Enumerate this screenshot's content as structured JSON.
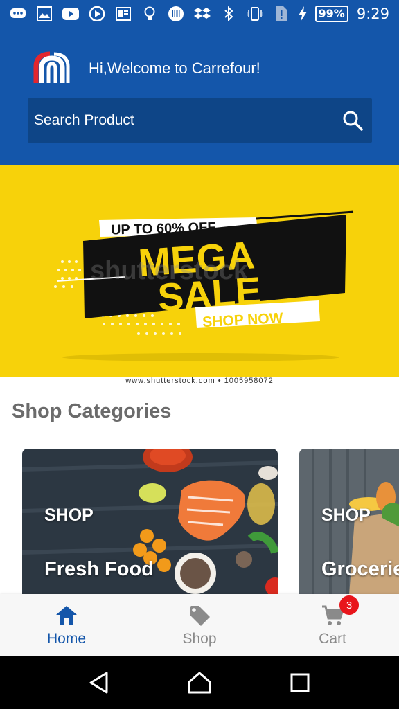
{
  "status_bar": {
    "battery": "99%",
    "time": "9:29"
  },
  "header": {
    "welcome": "Hi,Welcome to Carrefour!",
    "search_placeholder": "Search Product"
  },
  "banner": {
    "line1": "UP TO 60% OFF",
    "line2": "MEGA",
    "line3": "SALE",
    "cta": "SHOP NOW",
    "watermark": "shutterstock",
    "credit": "www.shutterstock.com • 1005958072"
  },
  "categories": {
    "title": "Shop Categories",
    "items": [
      {
        "tag": "SHOP",
        "name": "Fresh Food"
      },
      {
        "tag": "SHOP",
        "name": "Groceries"
      }
    ]
  },
  "bottom_nav": {
    "items": [
      {
        "label": "Home",
        "icon": "home-icon",
        "active": true
      },
      {
        "label": "Shop",
        "icon": "tag-icon",
        "active": false
      },
      {
        "label": "Cart",
        "icon": "cart-icon",
        "active": false,
        "badge": "3"
      }
    ]
  },
  "colors": {
    "brand_blue": "#1456aa",
    "search_bg": "#0e4587",
    "banner_yellow": "#f7d20a",
    "badge_red": "#e8151b"
  }
}
